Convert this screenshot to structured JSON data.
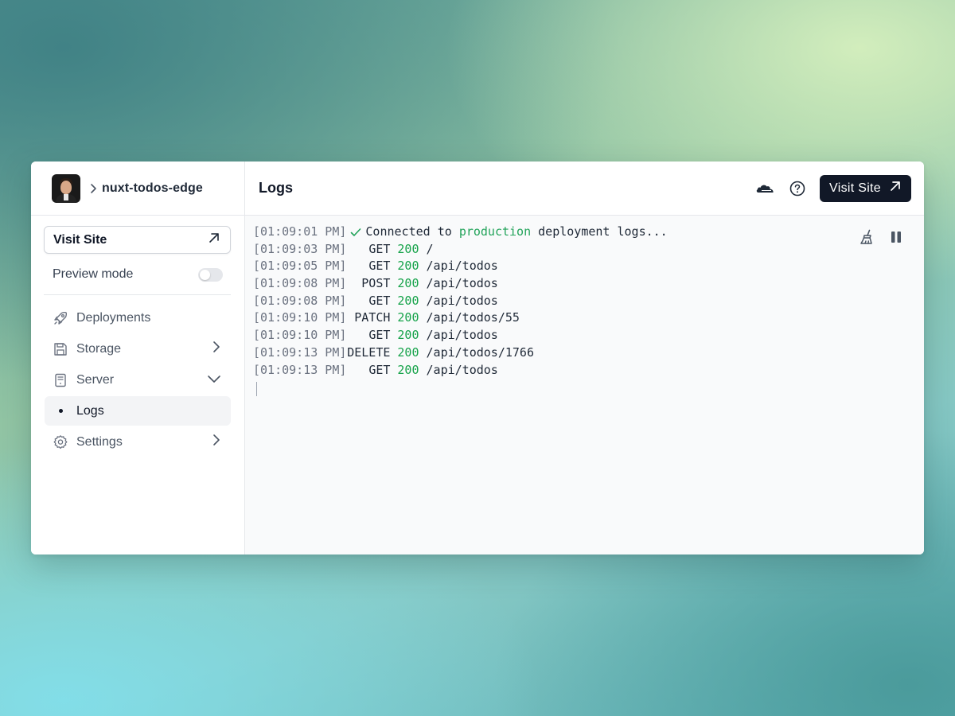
{
  "project": {
    "name": "nuxt-todos-edge"
  },
  "sidebar": {
    "visit_site_label": "Visit Site",
    "preview_mode_label": "Preview mode",
    "preview_mode_enabled": false,
    "items": [
      {
        "label": "Deployments",
        "icon": "rocket-icon"
      },
      {
        "label": "Storage",
        "icon": "floppy-disk-icon",
        "chevron": "right"
      },
      {
        "label": "Server",
        "icon": "server-icon",
        "chevron": "down"
      },
      {
        "label": "Logs",
        "active": true
      },
      {
        "label": "Settings",
        "icon": "gear-icon",
        "chevron": "right"
      }
    ]
  },
  "header": {
    "title": "Logs",
    "visit_site_label": "Visit Site",
    "icons": [
      "cloudflare-icon",
      "help-icon"
    ]
  },
  "logs": {
    "connected": {
      "timestamp": "[01:09:01 PM]",
      "prefix": "Connected to",
      "env": "production",
      "suffix": "deployment logs..."
    },
    "entries": [
      {
        "timestamp": "[01:09:03 PM]",
        "method": "GET",
        "status": "200",
        "path": "/"
      },
      {
        "timestamp": "[01:09:05 PM]",
        "method": "GET",
        "status": "200",
        "path": "/api/todos"
      },
      {
        "timestamp": "[01:09:08 PM]",
        "method": "POST",
        "status": "200",
        "path": "/api/todos"
      },
      {
        "timestamp": "[01:09:08 PM]",
        "method": "GET",
        "status": "200",
        "path": "/api/todos"
      },
      {
        "timestamp": "[01:09:10 PM]",
        "method": "PATCH",
        "status": "200",
        "path": "/api/todos/55"
      },
      {
        "timestamp": "[01:09:10 PM]",
        "method": "GET",
        "status": "200",
        "path": "/api/todos"
      },
      {
        "timestamp": "[01:09:13 PM]",
        "method": "DELETE",
        "status": "200",
        "path": "/api/todos/1766"
      },
      {
        "timestamp": "[01:09:13 PM]",
        "method": "GET",
        "status": "200",
        "path": "/api/todos"
      }
    ],
    "tools": [
      "clear-logs-icon",
      "pause-icon"
    ]
  },
  "colors": {
    "accent_dark": "#111827",
    "status_green": "#16a34a",
    "console_bg": "#f9fafb"
  }
}
